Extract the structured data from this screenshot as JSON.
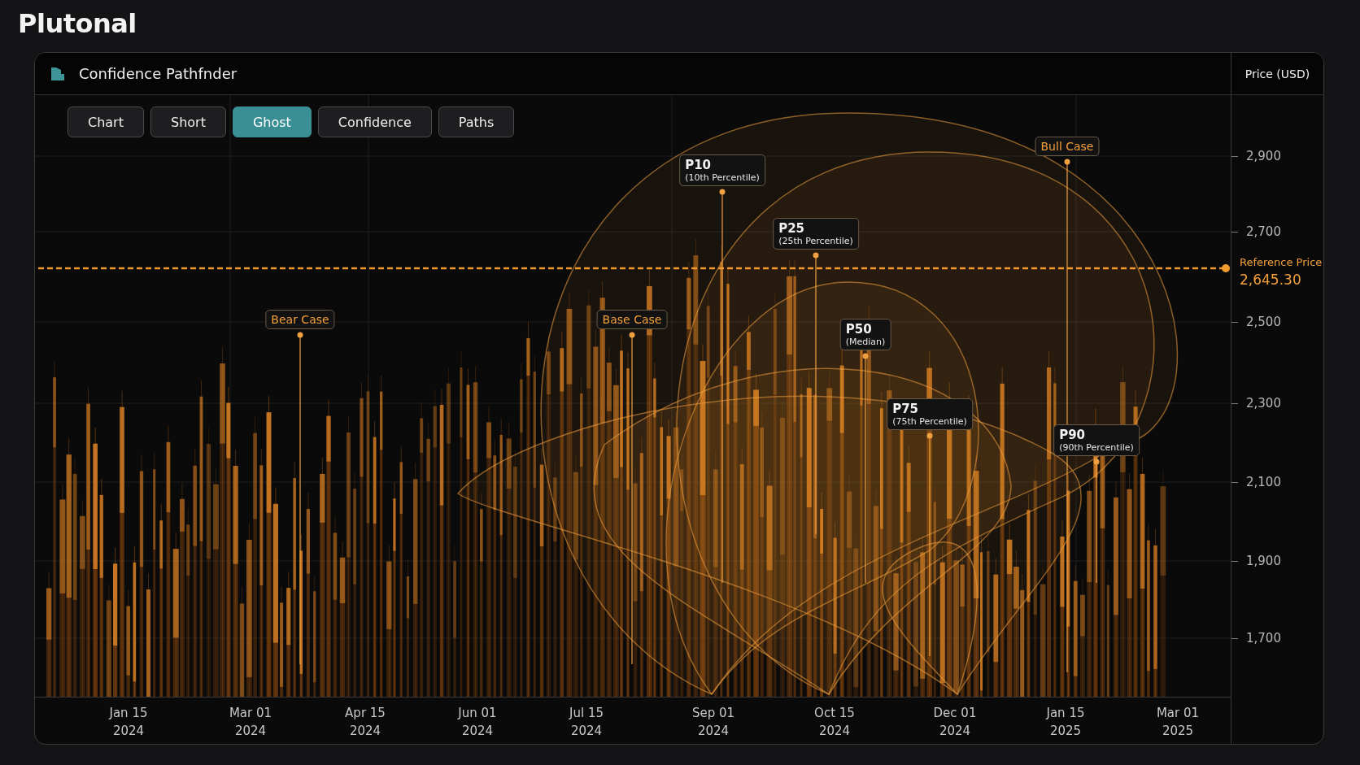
{
  "app_title": "Plutonal",
  "panel": {
    "title": "Confidence Pathfnder",
    "axis_title": "Price (USD)"
  },
  "tabs": [
    {
      "label": "Chart",
      "selected": false
    },
    {
      "label": "Short",
      "selected": false
    },
    {
      "label": "Ghost",
      "selected": true
    },
    {
      "label": "Confidence",
      "selected": false
    },
    {
      "label": "Paths",
      "selected": false
    }
  ],
  "reference_price": {
    "label": "Reference Price",
    "value": "2,645.30"
  },
  "callouts": [
    {
      "kind": "scenario",
      "title": "Bear Case"
    },
    {
      "kind": "scenario",
      "title": "Base Case"
    },
    {
      "kind": "percentile",
      "title": "P10",
      "subtitle": "(10th Percentile)"
    },
    {
      "kind": "percentile",
      "title": "P25",
      "subtitle": "(25th Percentile)"
    },
    {
      "kind": "percentile",
      "title": "P50",
      "subtitle": "(Median)"
    },
    {
      "kind": "percentile",
      "title": "P75",
      "subtitle": "(75th Percentile)"
    },
    {
      "kind": "scenario",
      "title": "Bull Case"
    },
    {
      "kind": "percentile",
      "title": "P90",
      "subtitle": "(90th Percentile)"
    }
  ],
  "y_ticks": [
    "2,900",
    "2,700",
    "2,500",
    "2,300",
    "2,100",
    "1,900",
    "1,700"
  ],
  "x_labels": [
    {
      "date": "Jan 15",
      "year": "2024"
    },
    {
      "date": "Mar 01",
      "year": "2024"
    },
    {
      "date": "Apr 15",
      "year": "2024"
    },
    {
      "date": "Jun 01",
      "year": "2024"
    },
    {
      "date": "Jul 15",
      "year": "2024"
    },
    {
      "date": "Sep 01",
      "year": "2024"
    },
    {
      "date": "Oct 15",
      "year": "2024"
    },
    {
      "date": "Dec 01",
      "year": "2024"
    },
    {
      "date": "Jan 15",
      "year": "2025"
    },
    {
      "date": "Mar 01",
      "year": "2025"
    }
  ]
}
